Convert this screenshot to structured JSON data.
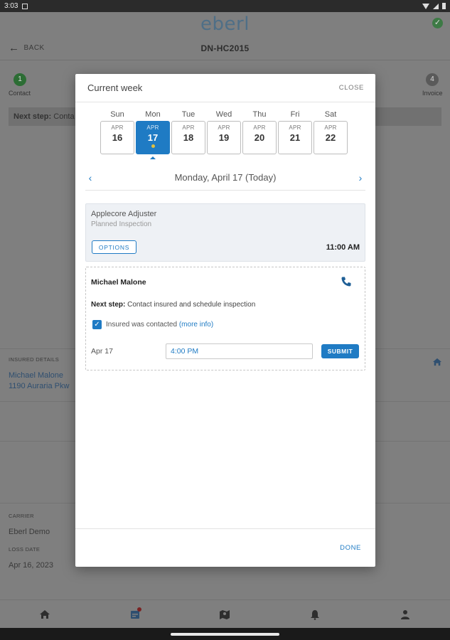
{
  "status_bar": {
    "time": "3:03"
  },
  "app": {
    "logo": "eberl",
    "back_label": "BACK",
    "claim_id": "DN-HC2015",
    "steps": [
      {
        "number": "1",
        "label": "Contact",
        "color": "#2c6d34"
      },
      {
        "number": "4",
        "label": "Invoice",
        "color": "#5a5a5a"
      }
    ],
    "next_step_prefix": "Next step:",
    "next_step_text": "Conta",
    "insured_details_label": "INSURED DETAILS",
    "insured_name": "Michael Malone",
    "insured_address": "1190 Auraria Pkw",
    "carrier_label": "CARRIER",
    "carrier_value": "Eberl Demo",
    "loss_date_label": "LOSS DATE",
    "loss_date_value": "Apr 16, 2023"
  },
  "bottom_nav": {
    "items": [
      "home-icon",
      "calendar-icon",
      "map-icon",
      "bell-icon",
      "person-icon"
    ]
  },
  "modal": {
    "title": "Current week",
    "close_label": "CLOSE",
    "days": [
      {
        "name": "Sun",
        "month": "APR",
        "num": "16",
        "selected": false
      },
      {
        "name": "Mon",
        "month": "APR",
        "num": "17",
        "selected": true
      },
      {
        "name": "Tue",
        "month": "APR",
        "num": "18",
        "selected": false
      },
      {
        "name": "Wed",
        "month": "APR",
        "num": "19",
        "selected": false
      },
      {
        "name": "Thu",
        "month": "APR",
        "num": "20",
        "selected": false
      },
      {
        "name": "Fri",
        "month": "APR",
        "num": "21",
        "selected": false
      },
      {
        "name": "Sat",
        "month": "APR",
        "num": "22",
        "selected": false
      }
    ],
    "date_label": "Monday, April 17 (Today)",
    "event": {
      "title": "Applecore Adjuster",
      "subtitle": "Planned Inspection",
      "options_label": "OPTIONS",
      "time": "11:00 AM"
    },
    "task": {
      "name": "Michael Malone",
      "next_step_prefix": "Next step:",
      "next_step_text": "Contact insured and schedule inspection",
      "checkbox_label": "Insured was contacted",
      "more_info": "(more info)",
      "date": "Apr 17",
      "time_value": "4:00 PM",
      "submit_label": "SUBMIT"
    },
    "done_label": "DONE"
  },
  "colors": {
    "accent": "#1f7bc4",
    "selected_dot": "#e0c040"
  }
}
